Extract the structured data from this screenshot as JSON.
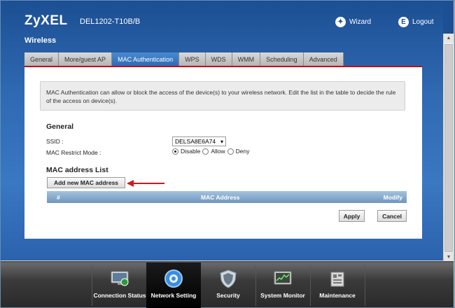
{
  "header": {
    "logo": "ZyXEL",
    "model": "DEL1202-T10B/B",
    "wizard": "Wizard",
    "logout": "Logout"
  },
  "section_title": "Wireless",
  "tabs": [
    {
      "label": "General",
      "active": false
    },
    {
      "label": "More/guest AP",
      "active": false
    },
    {
      "label": "MAC Authentication",
      "active": true
    },
    {
      "label": "WPS",
      "active": false
    },
    {
      "label": "WDS",
      "active": false
    },
    {
      "label": "WMM",
      "active": false
    },
    {
      "label": "Scheduling",
      "active": false
    },
    {
      "label": "Advanced",
      "active": false
    }
  ],
  "info_text": "MAC Authentication can allow or block the access of the device(s) to your wireless network. Edit the list in the table to decide the rule of the access on device(s).",
  "general": {
    "heading": "General",
    "ssid_label": "SSID :",
    "ssid_value": "DELSA8E6A74",
    "mac_restrict_label": "MAC Restrict Mode :",
    "mode_options": [
      {
        "label": "Disable",
        "selected": true
      },
      {
        "label": "Allow",
        "selected": false
      },
      {
        "label": "Deny",
        "selected": false
      }
    ]
  },
  "mac_list": {
    "heading": "MAC address List",
    "add_button": "Add new MAC address",
    "columns": [
      "#",
      "MAC Address",
      "Modify"
    ]
  },
  "buttons": {
    "apply": "Apply",
    "cancel": "Cancel"
  },
  "bottom_nav": [
    {
      "label": "Connection Status",
      "icon": "monitor-icon",
      "active": false
    },
    {
      "label": "Network Setting",
      "icon": "gear-globe-icon",
      "active": true
    },
    {
      "label": "Security",
      "icon": "shield-icon",
      "active": false
    },
    {
      "label": "System Monitor",
      "icon": "chart-monitor-icon",
      "active": false
    },
    {
      "label": "Maintenance",
      "icon": "toolbox-icon",
      "active": false
    }
  ],
  "colors": {
    "accent_red": "#b5121b",
    "header_blue": "#1c4f93",
    "tab_active": "#2d6cb5"
  }
}
